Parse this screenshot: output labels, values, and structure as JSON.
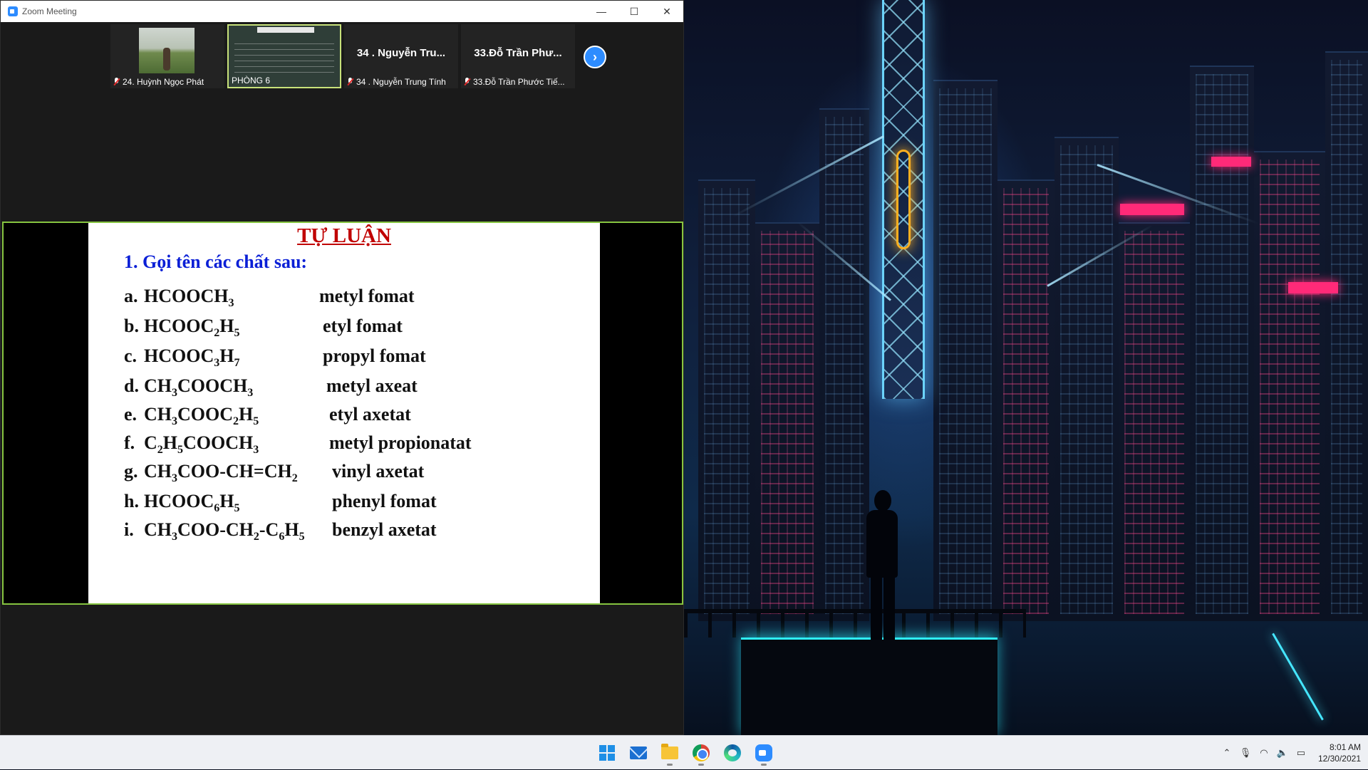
{
  "window": {
    "title": "Zoom Meeting",
    "controls": {
      "minimize": "—",
      "maximize": "☐",
      "close": "✕"
    }
  },
  "participants": [
    {
      "label": "24. Huỳnh Ngọc Phát",
      "muted": true,
      "kind": "video"
    },
    {
      "label": "PHÒNG 6",
      "muted": false,
      "kind": "board"
    },
    {
      "name": "34 . Nguyễn Tru...",
      "label": "34 . Nguyễn Trung Tính",
      "muted": true,
      "kind": "name"
    },
    {
      "name": "33.Đỗ Trần Phư...",
      "label": "33.Đỗ Trần Phước Tiế...",
      "muted": true,
      "kind": "name"
    }
  ],
  "next_button": "›",
  "slide": {
    "title": "TỰ LUẬN",
    "subtitle": "1. Gọi tên các chất sau:",
    "rows": [
      {
        "label": "a.",
        "name": "metyl fomat"
      },
      {
        "label": "b.",
        "name": "etyl fomat"
      },
      {
        "label": "c.",
        "name": "propyl fomat"
      },
      {
        "label": "d.",
        "name": "metyl axeat"
      },
      {
        "label": "e.",
        "name": "etyl axetat"
      },
      {
        "label": "f.",
        "name": "metyl propionatat"
      },
      {
        "label": "g.",
        "name": "vinyl axetat"
      },
      {
        "label": "h.",
        "name": "phenyl fomat"
      },
      {
        "label": "i.",
        "name": "benzyl axetat"
      }
    ]
  },
  "taskbar": {
    "apps": [
      "start-icon",
      "mail-icon",
      "file-explorer-icon",
      "chrome-icon",
      "edge-icon",
      "zoom-icon"
    ],
    "time": "8:01 AM",
    "date": "12/30/2021"
  },
  "colors": {
    "zoom_blue": "#2d8cff",
    "share_border": "#86c440",
    "slide_title": "#c00000",
    "slide_subtitle": "#0a1fd6"
  }
}
